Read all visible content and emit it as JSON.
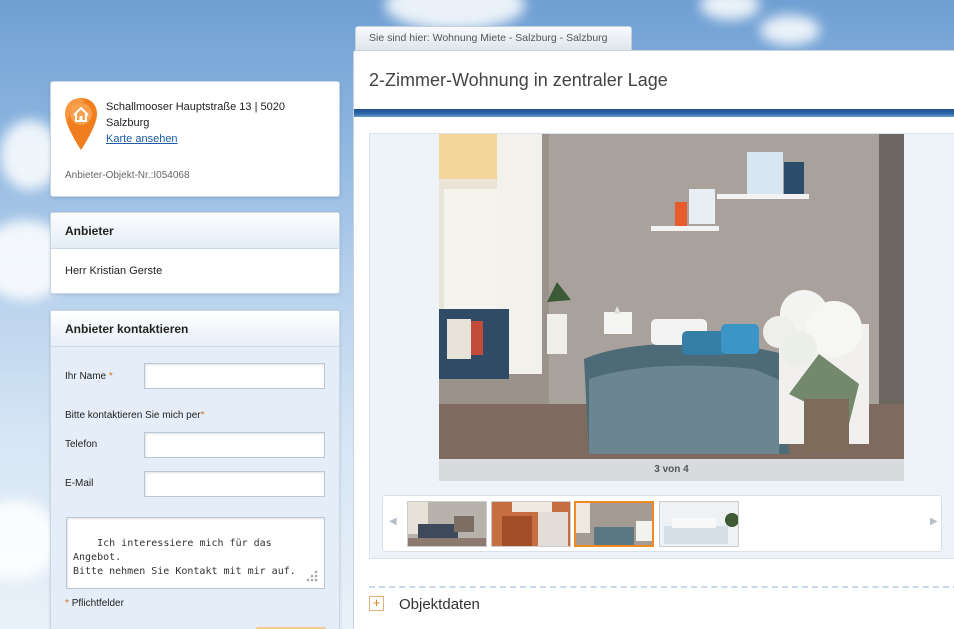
{
  "location": {
    "address": "Schallmooser Hauptstraße 13 | 5020 Salzburg",
    "map_link": "Karte ansehen",
    "object_number": "Anbieter-Objekt-Nr.:I054068"
  },
  "provider": {
    "heading": "Anbieter",
    "name": "Herr Kristian Gerste"
  },
  "contact": {
    "heading": "Anbieter kontaktieren",
    "name_label": "Ihr Name",
    "required_mark": "*",
    "contact_via_label": "Bitte kontaktieren Sie mich per",
    "phone_label": "Telefon",
    "email_label": "E-Mail",
    "message": "Ich interessiere mich für das Angebot.\nBitte nehmen Sie Kontakt mit mir auf.",
    "required_note": "Pflichtfelder"
  },
  "breadcrumb": "Sie sind hier: Wohnung Miete - Salzburg - Salzburg",
  "listing": {
    "title": "2-Zimmer-Wohnung in zentraler Lage"
  },
  "gallery": {
    "counter": "3 von 4",
    "current_index": 3,
    "total": 4
  },
  "sections": {
    "objektdaten": "Objektdaten",
    "expand_symbol": "+"
  },
  "colors": {
    "accent_orange": "#f08a24",
    "title_bar_blue": "#2e69ad",
    "link_blue": "#1b5ca8"
  }
}
